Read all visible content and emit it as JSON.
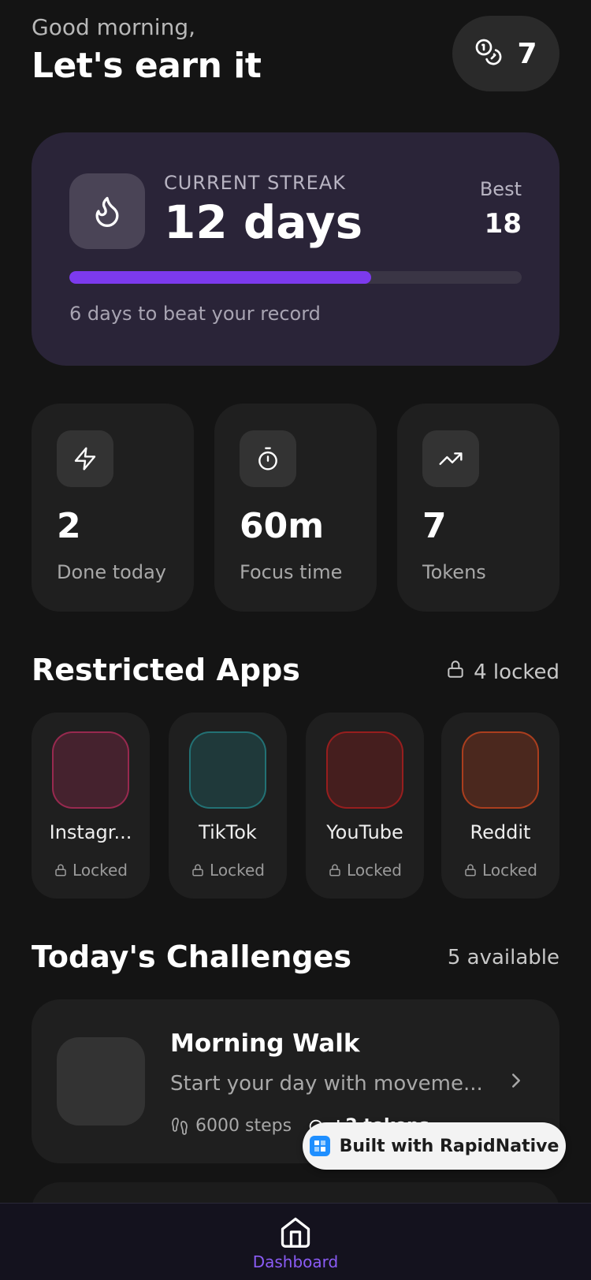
{
  "header": {
    "greeting": "Good morning,",
    "headline": "Let's earn it",
    "token_count": "7"
  },
  "streak": {
    "label": "CURRENT STREAK",
    "value": "12 days",
    "best_label": "Best",
    "best_value": "18",
    "progress_fraction": 0.667,
    "note": "6 days to beat your record"
  },
  "stats": [
    {
      "icon": "lightning-icon",
      "value": "2",
      "label": "Done today"
    },
    {
      "icon": "stopwatch-icon",
      "value": "60m",
      "label": "Focus time"
    },
    {
      "icon": "trending-up-icon",
      "value": "7",
      "label": "Tokens"
    }
  ],
  "restricted": {
    "title": "Restricted Apps",
    "meta": "4 locked",
    "apps": [
      {
        "name": "Instagr...",
        "status": "Locked",
        "color": "#e1306c"
      },
      {
        "name": "TikTok",
        "status": "Locked",
        "color": "#25a4a8"
      },
      {
        "name": "YouTube",
        "status": "Locked",
        "color": "#e02020"
      },
      {
        "name": "Reddit",
        "status": "Locked",
        "color": "#ff5220"
      }
    ]
  },
  "challenges": {
    "title": "Today's Challenges",
    "meta": "5 available",
    "items": [
      {
        "title": "Morning Walk",
        "desc": "Start your day with moveme...",
        "steps": "6000 steps",
        "reward": "+2 tokens"
      }
    ]
  },
  "badge": {
    "text": "Built with RapidNative"
  },
  "tabbar": {
    "home_label": "Dashboard"
  },
  "colors": {
    "accent": "#7c3aed",
    "card": "#1f1f1f",
    "streak_card": "#2a2438"
  }
}
